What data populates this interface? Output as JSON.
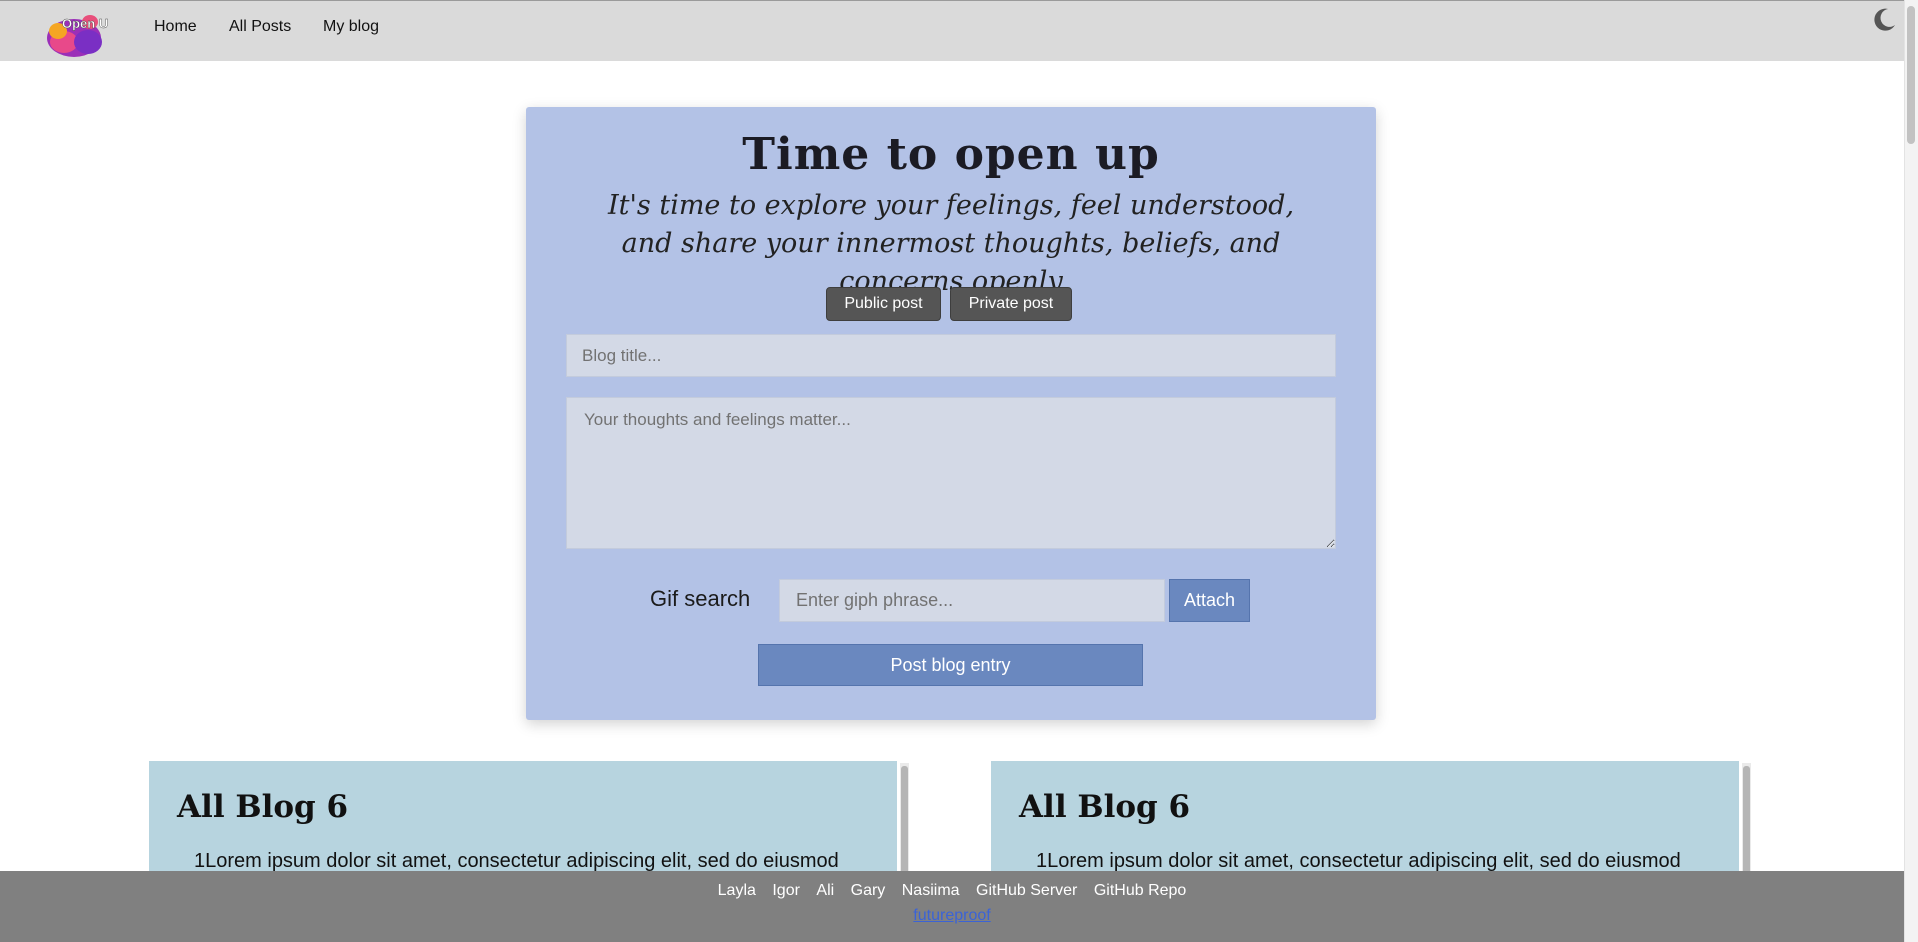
{
  "nav": {
    "logo_text": "Open Up",
    "links": [
      "Home",
      "All Posts",
      "My blog"
    ]
  },
  "composer": {
    "title": "Time to open up",
    "subtitle": "It's time to explore your feelings, feel understood, and share your innermost thoughts, beliefs, and concerns openly",
    "public_label": "Public post",
    "private_label": "Private post",
    "title_placeholder": "Blog title...",
    "body_placeholder": "Your thoughts and feelings matter...",
    "gif_label": "Gif search",
    "gif_placeholder": "Enter giph phrase...",
    "attach_label": "Attach",
    "post_label": "Post blog entry"
  },
  "posts": [
    {
      "heading": "All Blog 6",
      "body": "1Lorem ipsum dolor sit amet, consectetur adipiscing elit, sed do eiusmod"
    },
    {
      "heading": "All Blog 6",
      "body": "1Lorem ipsum dolor sit amet, consectetur adipiscing elit, sed do eiusmod"
    }
  ],
  "footer": {
    "links": [
      "Layla",
      "Igor",
      "Ali",
      "Gary",
      "Nasiima",
      "GitHub Server",
      "GitHub Repo"
    ],
    "org": "futureproof"
  },
  "colors": {
    "nav_bg": "#dadada",
    "composer_bg": "#b3c2e6",
    "button_dark": "#555555",
    "button_accent": "#6a88bf",
    "card_bg": "#b7d4df",
    "footer_bg": "#808080",
    "footer_link": "#3b63d6"
  },
  "icons": {
    "logo": "open-up-logo",
    "theme_toggle": "moon-icon"
  }
}
